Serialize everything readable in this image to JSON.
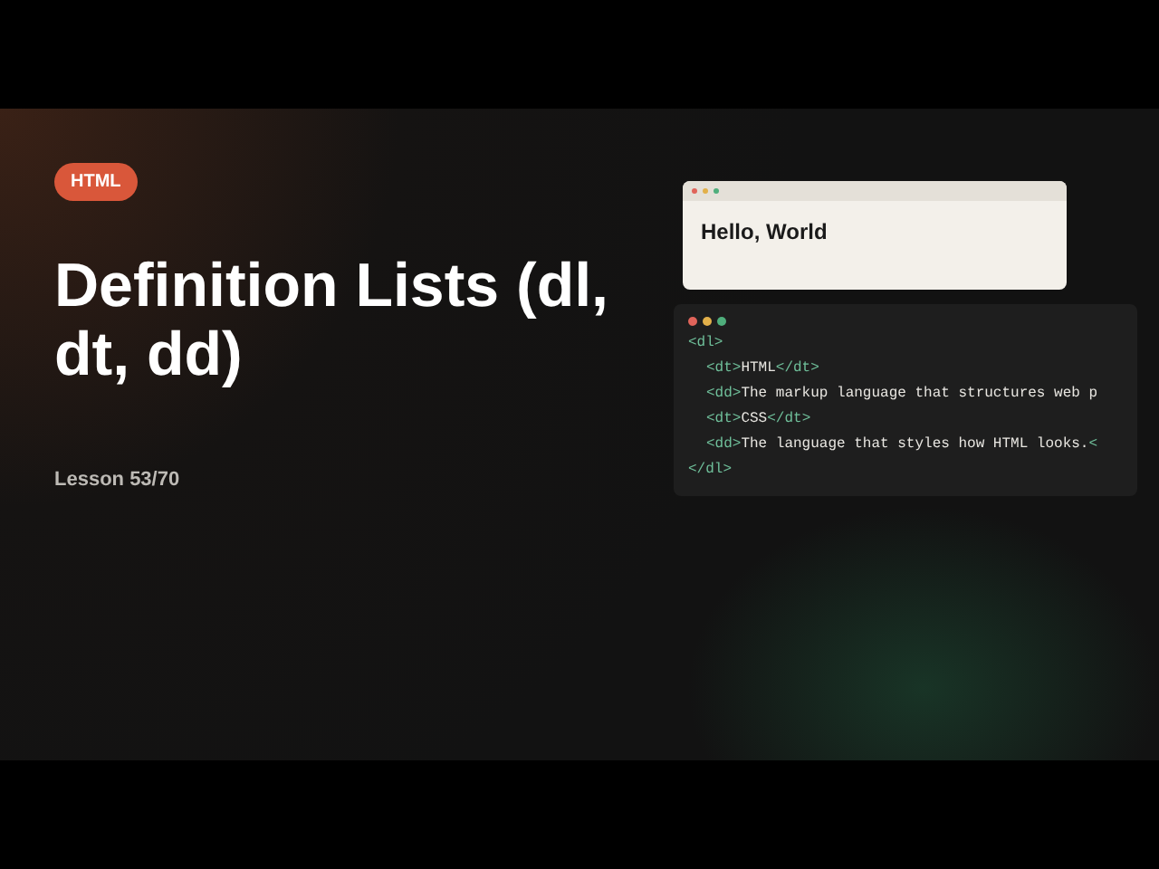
{
  "badge": "HTML",
  "title": "Definition Lists (dl, dt, dd)",
  "lesson": "Lesson 53/70",
  "preview": {
    "heading": "Hello, World"
  },
  "code": {
    "lines": [
      "<dl>",
      "  <dt>HTML</dt>",
      "  <dd>The markup language that structures web p",
      "  <dt>CSS</dt>",
      "  <dd>The language that styles how HTML looks.<",
      "</dl>"
    ]
  }
}
